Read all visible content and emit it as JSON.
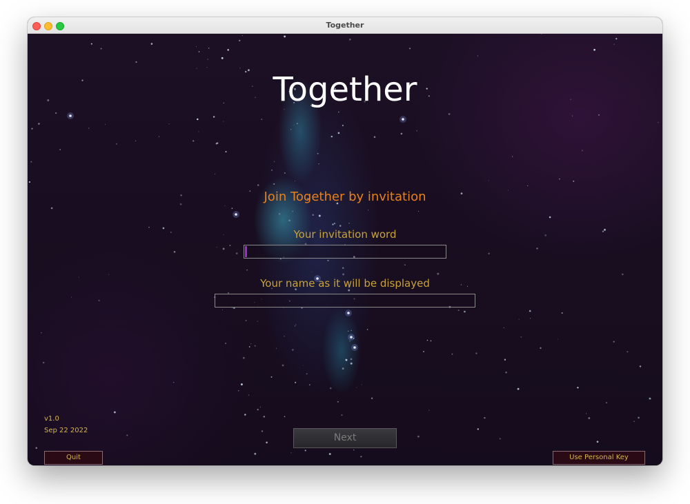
{
  "window": {
    "title": "Together"
  },
  "app": {
    "title": "Together",
    "subtitle": "Join Together by invitation"
  },
  "form": {
    "invitation_label": "Your invitation word",
    "invitation_value": "",
    "name_label": "Your name as it will be displayed",
    "name_value": ""
  },
  "meta": {
    "version": "v1.0",
    "date": "Sep 22 2022"
  },
  "buttons": {
    "quit": "Quit",
    "next": "Next",
    "personal_key": "Use Personal Key"
  },
  "colors": {
    "title": "#ffffff",
    "subtitle": "#e8811a",
    "label": "#c8a23a",
    "caret": "#9b2fc9",
    "button_bg": "#2a0a14"
  }
}
